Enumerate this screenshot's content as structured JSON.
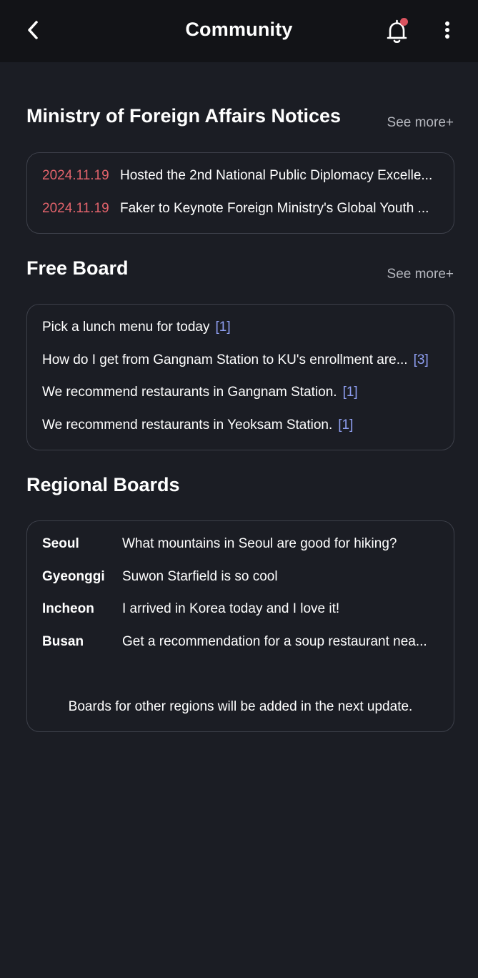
{
  "header": {
    "title": "Community",
    "back_icon": "chevron-left-icon",
    "bell_icon": "bell-icon",
    "menu_icon": "more-vertical-icon",
    "notification_dot_color": "#d9535f"
  },
  "notices": {
    "title": "Ministry of Foreign Affairs Notices",
    "see_more": "See more+",
    "items": [
      {
        "date": "2024.11.19",
        "text": "Hosted the 2nd National Public Diplomacy Excelle..."
      },
      {
        "date": "2024.11.19",
        "text": "Faker to Keynote Foreign Ministry's Global Youth ..."
      }
    ]
  },
  "free_board": {
    "title": "Free Board",
    "see_more": "See more+",
    "items": [
      {
        "text": "Pick a lunch menu for today",
        "count": "[1]"
      },
      {
        "text": "How do I get from Gangnam Station to KU's enrollment are...",
        "count": "[3]"
      },
      {
        "text": "We recommend restaurants in Gangnam Station.",
        "count": "[1]"
      },
      {
        "text": "We recommend restaurants in Yeoksam Station.",
        "count": "[1]"
      }
    ]
  },
  "regional": {
    "title": "Regional Boards",
    "items": [
      {
        "region": "Seoul",
        "text": "What mountains in Seoul are good for hiking?"
      },
      {
        "region": "Gyeonggi",
        "text": "Suwon Starfield is so cool"
      },
      {
        "region": "Incheon",
        "text": "I arrived in Korea today and I love it!"
      },
      {
        "region": "Busan",
        "text": "Get a recommendation for a soup restaurant nea..."
      }
    ],
    "footnote": "Boards for other regions will be added in the next update."
  },
  "colors": {
    "background": "#1b1d24",
    "topbar": "#121317",
    "date_accent": "#e2636b",
    "count_accent": "#8f9ff2",
    "muted_text": "#b4b6bd",
    "card_border": "#3d404a"
  }
}
